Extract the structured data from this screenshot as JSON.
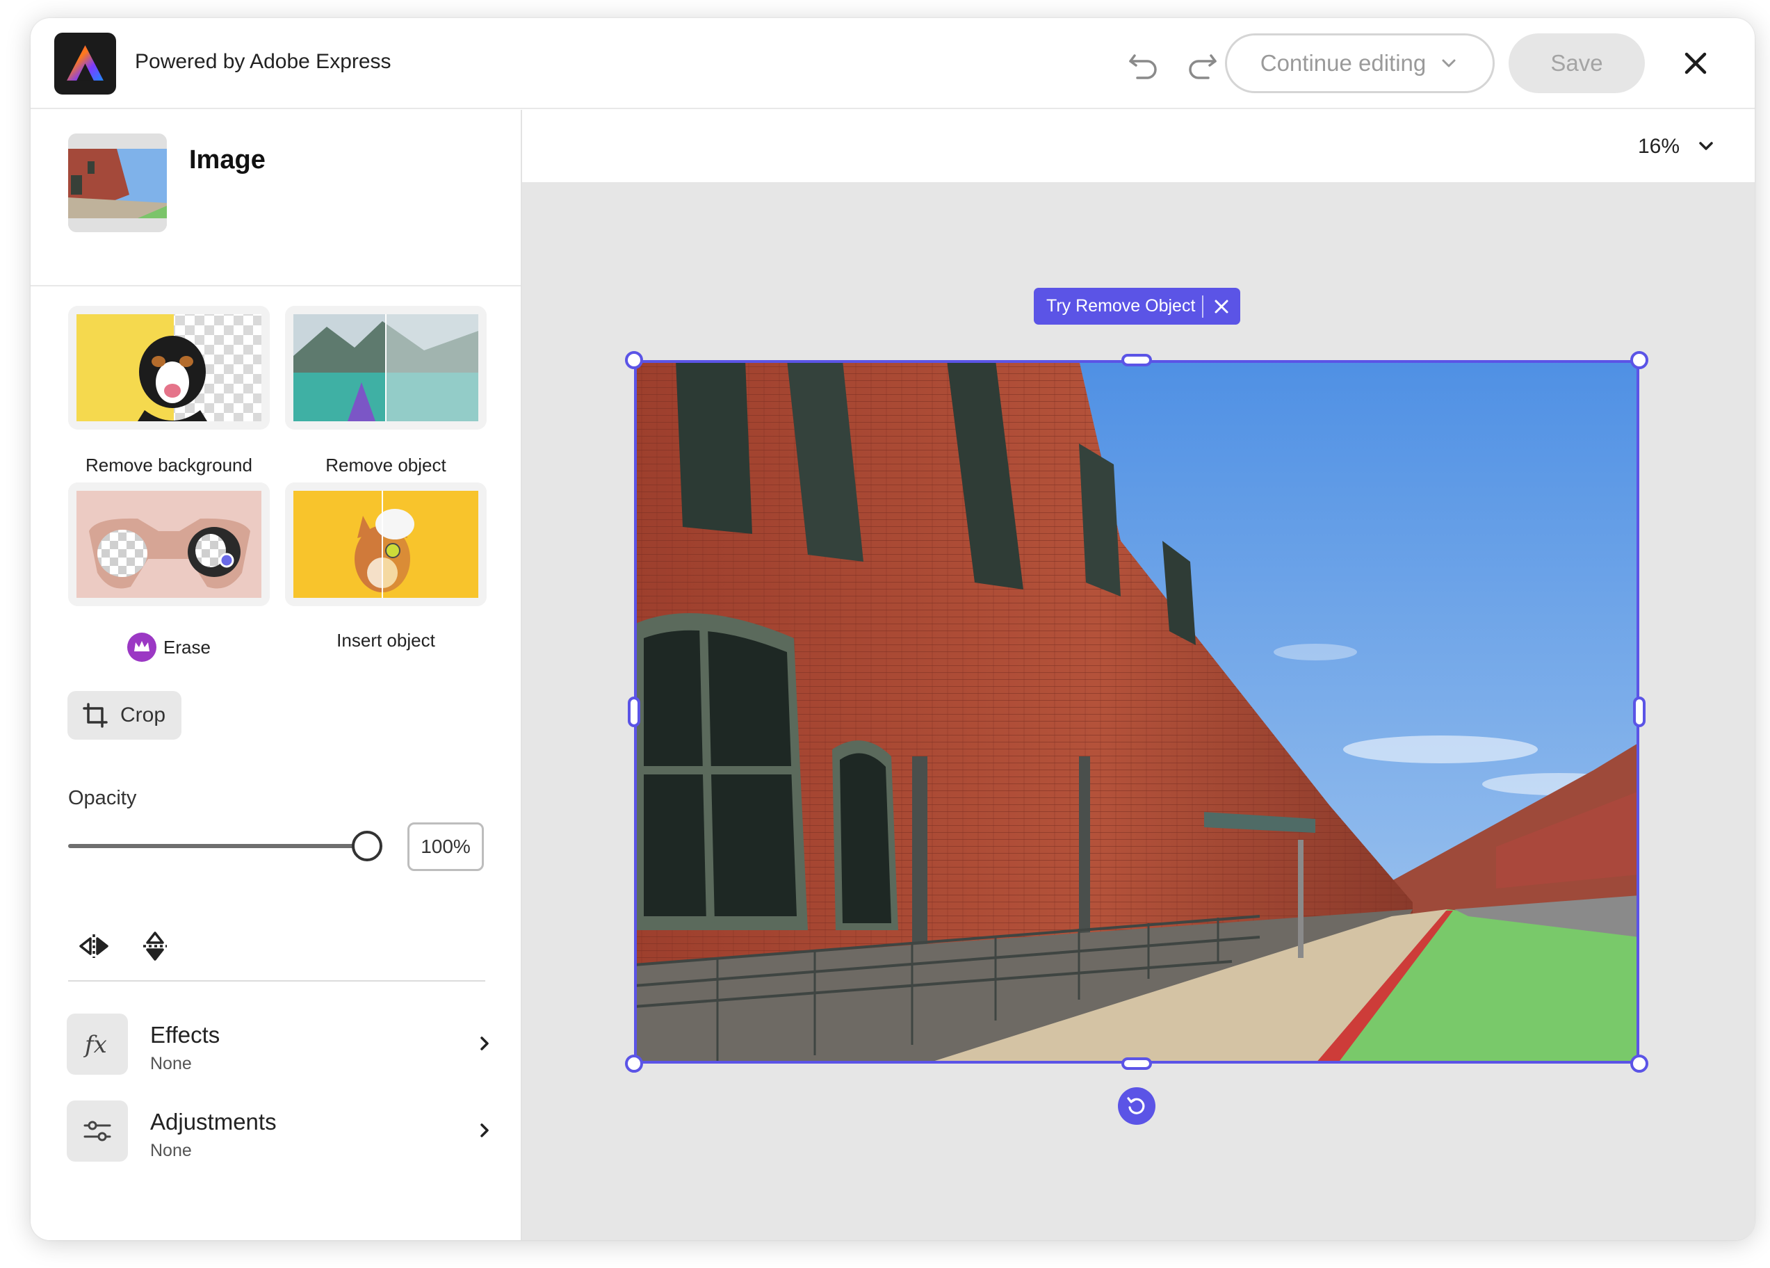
{
  "header": {
    "app_title": "Powered by Adobe Express",
    "logo_icon": "adobe-express-logo",
    "undo_icon": "undo-icon",
    "redo_icon": "redo-icon",
    "continue_label": "Continue editing",
    "save_label": "Save",
    "close_icon": "close-icon"
  },
  "sidebar": {
    "section_title": "Image",
    "tools": [
      {
        "label": "Remove background"
      },
      {
        "label": "Remove object"
      },
      {
        "label": "Erase",
        "badge": "premium-crown-icon"
      },
      {
        "label": "Insert object"
      }
    ],
    "crop_label": "Crop",
    "opacity": {
      "label": "Opacity",
      "value": "100%",
      "level": 1.0
    },
    "flip_icons": [
      "flip-horizontal-icon",
      "flip-vertical-icon"
    ],
    "rows": [
      {
        "title": "Effects",
        "subtitle": "None",
        "icon": "fx-icon"
      },
      {
        "title": "Adjustments",
        "subtitle": "None",
        "icon": "sliders-icon"
      }
    ]
  },
  "canvas": {
    "zoom": "16%",
    "try_remove_label": "Try Remove Object"
  },
  "colors": {
    "accent": "#5b54e6",
    "save_disabled_bg": "#e6e6e6",
    "canvas_bg": "#e6e6e6"
  }
}
